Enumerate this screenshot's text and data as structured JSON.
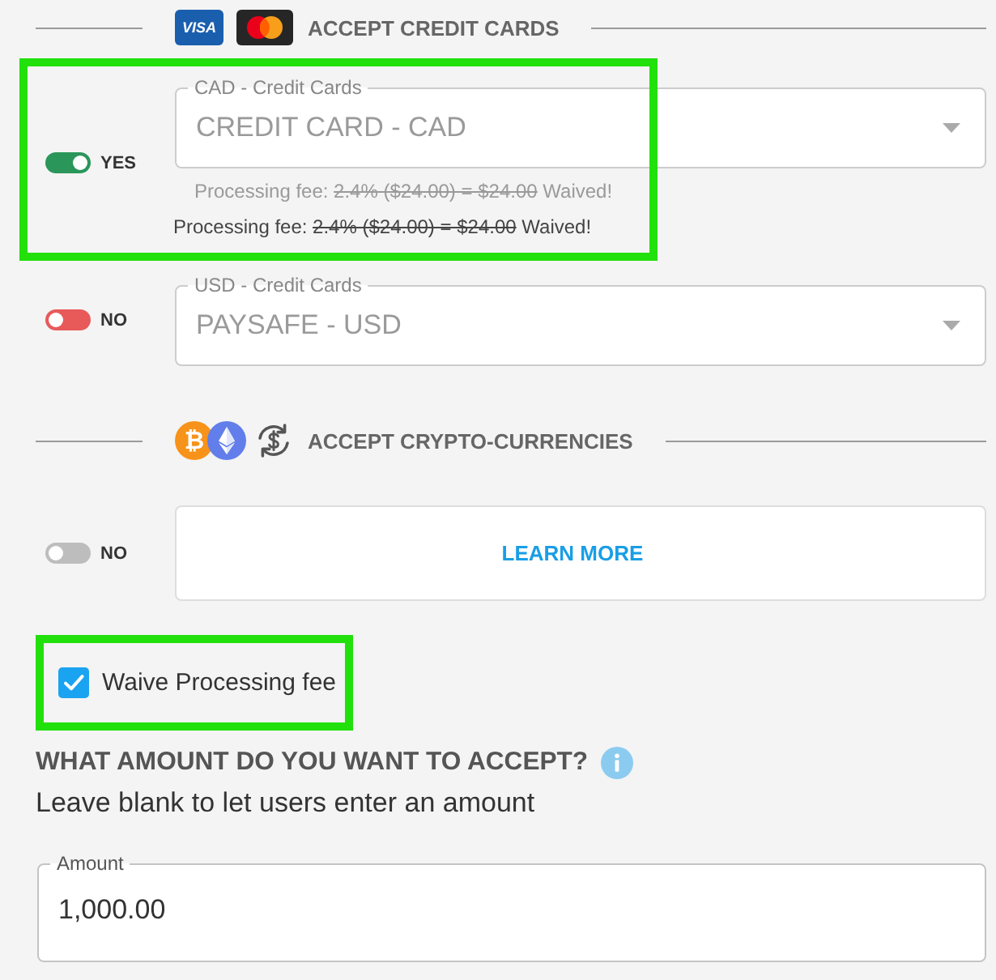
{
  "credit_cards": {
    "logos": [
      {
        "kind": "visa",
        "text": "VISA"
      },
      {
        "kind": "mastercard"
      }
    ],
    "title": "ACCEPT CREDIT CARDS"
  },
  "gateways": [
    {
      "highlighted": true,
      "toggle": {
        "on": true,
        "disabled": false,
        "label": "YES"
      },
      "select": {
        "label": "CAD - Credit Cards",
        "value": "CREDIT CARD - CAD"
      },
      "helper": {
        "label": "Processing fee:",
        "struck": "2.4% ($24.00) = $24.00",
        "note": "Waived!"
      },
      "fee_note": {
        "label": "Processing fee:",
        "struck": "2.4% ($24.00) = $24.00",
        "note": "Waived!"
      }
    },
    {
      "highlighted": false,
      "toggle": {
        "on": false,
        "disabled": false,
        "label": "NO"
      },
      "select": {
        "label": "USD - Credit Cards",
        "value": "PAYSAFE - USD"
      }
    }
  ],
  "crypto": {
    "logos": [
      {
        "kind": "bitcoin",
        "symbol": "₿"
      },
      {
        "kind": "ethereum"
      },
      {
        "kind": "exchange"
      }
    ],
    "title": "ACCEPT CRYPTO-CURRENCIES",
    "toggle": {
      "on": false,
      "disabled": true,
      "label": "NO"
    },
    "link": "LEARN MORE"
  },
  "waive_fee": {
    "highlighted": true,
    "checked": true,
    "label": "Waive Processing fee"
  },
  "amount": {
    "heading": "WHAT AMOUNT DO YOU WANT TO ACCEPT?",
    "hint": "Leave blank to let users enter an amount",
    "field": {
      "label": "Amount",
      "value": "1,000.00"
    }
  }
}
